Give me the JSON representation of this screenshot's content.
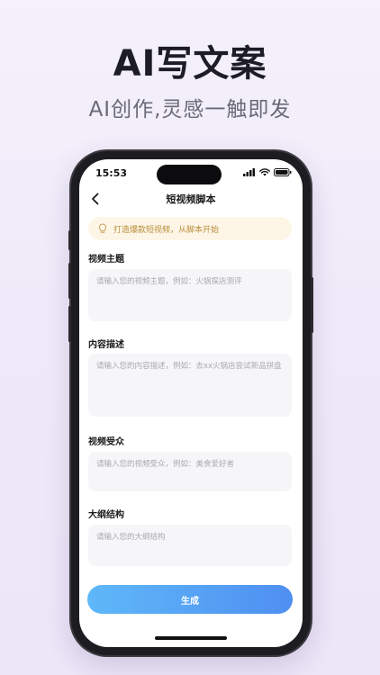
{
  "hero": {
    "title": "AI写文案",
    "subtitle": "AI创作,灵感一触即发"
  },
  "status_bar": {
    "time": "15:53"
  },
  "nav": {
    "title": "短视频脚本",
    "back_icon": "chevron-left-icon"
  },
  "tip": {
    "icon": "lightbulb-icon",
    "text": "打造爆款短视频，从脚本开始"
  },
  "form": {
    "fields": [
      {
        "label": "视频主题",
        "placeholder": "请输入您的视频主题，例如：火锅探店测评",
        "value": ""
      },
      {
        "label": "内容描述",
        "placeholder": "请输入您的内容描述，例如：去xx火锅店尝试新品拼盘",
        "value": ""
      },
      {
        "label": "视频受众",
        "placeholder": "请输入您的视频受众，例如：美食爱好者",
        "value": ""
      },
      {
        "label": "大纲结构",
        "placeholder": "请输入您的大纲结构",
        "value": ""
      }
    ],
    "submit_label": "生成"
  },
  "colors": {
    "accent_start": "#5fb8f8",
    "accent_end": "#4f8ff2",
    "tip_bg": "#fdf6e7",
    "tip_text": "#b88d3b"
  }
}
